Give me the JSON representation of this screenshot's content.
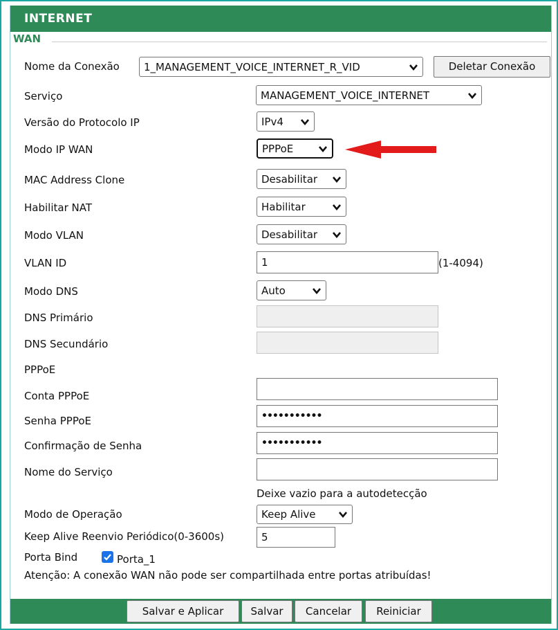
{
  "section_title": "INTERNET",
  "legend": "WAN",
  "connection": {
    "label": "Nome da Conexão",
    "value": "1_MANAGEMENT_VOICE_INTERNET_R_VID",
    "delete_button": "Deletar Conexão"
  },
  "rows": {
    "service": {
      "label": "Serviço",
      "value": "MANAGEMENT_VOICE_INTERNET"
    },
    "ip_version": {
      "label": "Versão do Protocolo IP",
      "value": "IPv4"
    },
    "wan_ip_mode": {
      "label": "Modo IP WAN",
      "value": "PPPoE"
    },
    "mac_clone": {
      "label": "MAC Address Clone",
      "value": "Desabilitar"
    },
    "nat": {
      "label": "Habilitar NAT",
      "value": "Habilitar"
    },
    "vlan_mode": {
      "label": "Modo VLAN",
      "value": "Desabilitar"
    },
    "vlan_id": {
      "label": "VLAN ID",
      "value": "1",
      "hint": "(1-4094)"
    },
    "dns_mode": {
      "label": "Modo DNS",
      "value": "Auto"
    },
    "dns_primary": {
      "label": "DNS Primário",
      "value": ""
    },
    "dns_secondary": {
      "label": "DNS Secundário",
      "value": ""
    },
    "pppoe_heading": "PPPoE",
    "pppoe_account": {
      "label": "Conta PPPoE",
      "value": ""
    },
    "pppoe_password": {
      "label": "Senha PPPoE",
      "value": "•••••••••••"
    },
    "password_confirm": {
      "label": "Confirmação de Senha",
      "value": "•••••••••••"
    },
    "service_name": {
      "label": "Nome do Serviço",
      "value": "",
      "hint": "Deixe vazio para a autodetecção"
    },
    "operation_mode": {
      "label": "Modo de Operação",
      "value": "Keep Alive"
    },
    "keep_alive": {
      "label": "Keep Alive Reenvio Periódico(0-3600s)",
      "value": "5"
    },
    "port_bind": {
      "label": "Porta Bind",
      "option": "Porta_1",
      "checked": true
    },
    "warning": "Atenção: A conexão WAN não pode ser compartilhada entre portas atribuídas!"
  },
  "footer_buttons": {
    "save_apply": "Salvar e Aplicar",
    "save": "Salvar",
    "cancel": "Cancelar",
    "restart": "Reiniciar"
  },
  "colors": {
    "header_green": "#2e8b57",
    "annotation_arrow": "#e31b1b",
    "checkbox_blue": "#1a73e8"
  },
  "icons": {
    "dropdown": "chevron-down-icon",
    "annotation": "red-arrow-icon",
    "checkbox": "checkmark-icon"
  }
}
